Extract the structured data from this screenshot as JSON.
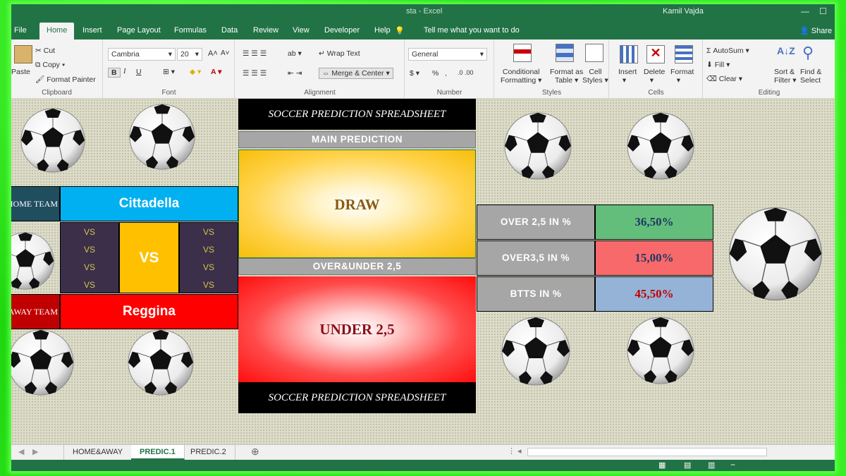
{
  "window": {
    "title": "sta - Excel",
    "user": "Kamil Vajda"
  },
  "tabs": [
    {
      "label": "File"
    },
    {
      "label": "Home"
    },
    {
      "label": "Insert"
    },
    {
      "label": "Page Layout"
    },
    {
      "label": "Formulas"
    },
    {
      "label": "Data"
    },
    {
      "label": "Review"
    },
    {
      "label": "View"
    },
    {
      "label": "Developer"
    },
    {
      "label": "Help"
    }
  ],
  "tell_me": "Tell me what you want to do",
  "share": "Share",
  "ribbon": {
    "clipboard": {
      "paste": "Paste",
      "cut": "Cut",
      "copy": "Copy",
      "format_painter": "Format Painter",
      "label": "Clipboard"
    },
    "font": {
      "name": "Cambria",
      "size": "20",
      "label": "Font",
      "bold": "B",
      "italic": "I",
      "underline": "U"
    },
    "alignment": {
      "wrap_text": "Wrap Text",
      "merge_center": "Merge & Center",
      "label": "Alignment"
    },
    "number": {
      "format": "General",
      "percent": "%",
      "comma": ",",
      "label": "Number"
    },
    "styles": {
      "conditional": "Conditional",
      "conditional2": "Formatting",
      "format_as": "Format as",
      "format_as2": "Table",
      "cell": "Cell",
      "cell2": "Styles",
      "label": "Styles"
    },
    "cells": {
      "insert": "Insert",
      "delete": "Delete",
      "format": "Format",
      "label": "Cells"
    },
    "editing": {
      "autosum": "AutoSum",
      "fill": "Fill",
      "clear": "Clear",
      "sort": "Sort &",
      "sort2": "Filter",
      "find": "Find &",
      "find2": "Select",
      "label": "Editing"
    }
  },
  "sheet": {
    "title_top": "SOCCER PREDICTION SPREADSHEET",
    "title_bottom": "SOCCER PREDICTION SPREADSHEET",
    "main_prediction_label": "MAIN PREDICTION",
    "main_prediction": "DRAW",
    "ou_label": "OVER&UNDER 2,5",
    "ou_prediction": "UNDER 2,5",
    "home_label": "HOME TEAM",
    "home_team": "Cittadella",
    "away_label": "AWAY TEAM",
    "away_team": "Reggina",
    "vs_big": "VS",
    "vs_small": [
      "VS",
      "VS",
      "VS",
      "VS"
    ],
    "stats": [
      {
        "label": "OVER 2,5 IN %",
        "value": "36,50%"
      },
      {
        "label": "OVER3,5 IN %",
        "value": "15,00%"
      },
      {
        "label": "BTTS IN %",
        "value": "45,50%"
      }
    ]
  },
  "sheet_tabs": [
    {
      "label": "HOME&AWAY"
    },
    {
      "label": "PREDIC.1"
    },
    {
      "label": "PREDIC.2"
    }
  ],
  "colors": {
    "excel_green": "#217346",
    "home_team_bg": "#00b0f0",
    "away_team_bg": "#ff0000",
    "vs_bg": "#ffc000",
    "stat1_bg": "#63be7b",
    "stat2_bg": "#f8696b",
    "stat3_bg": "#95b3d7",
    "stat1_fg": "#1f3864",
    "stat2_fg": "#1f3864",
    "stat3_fg": "#c00000"
  }
}
